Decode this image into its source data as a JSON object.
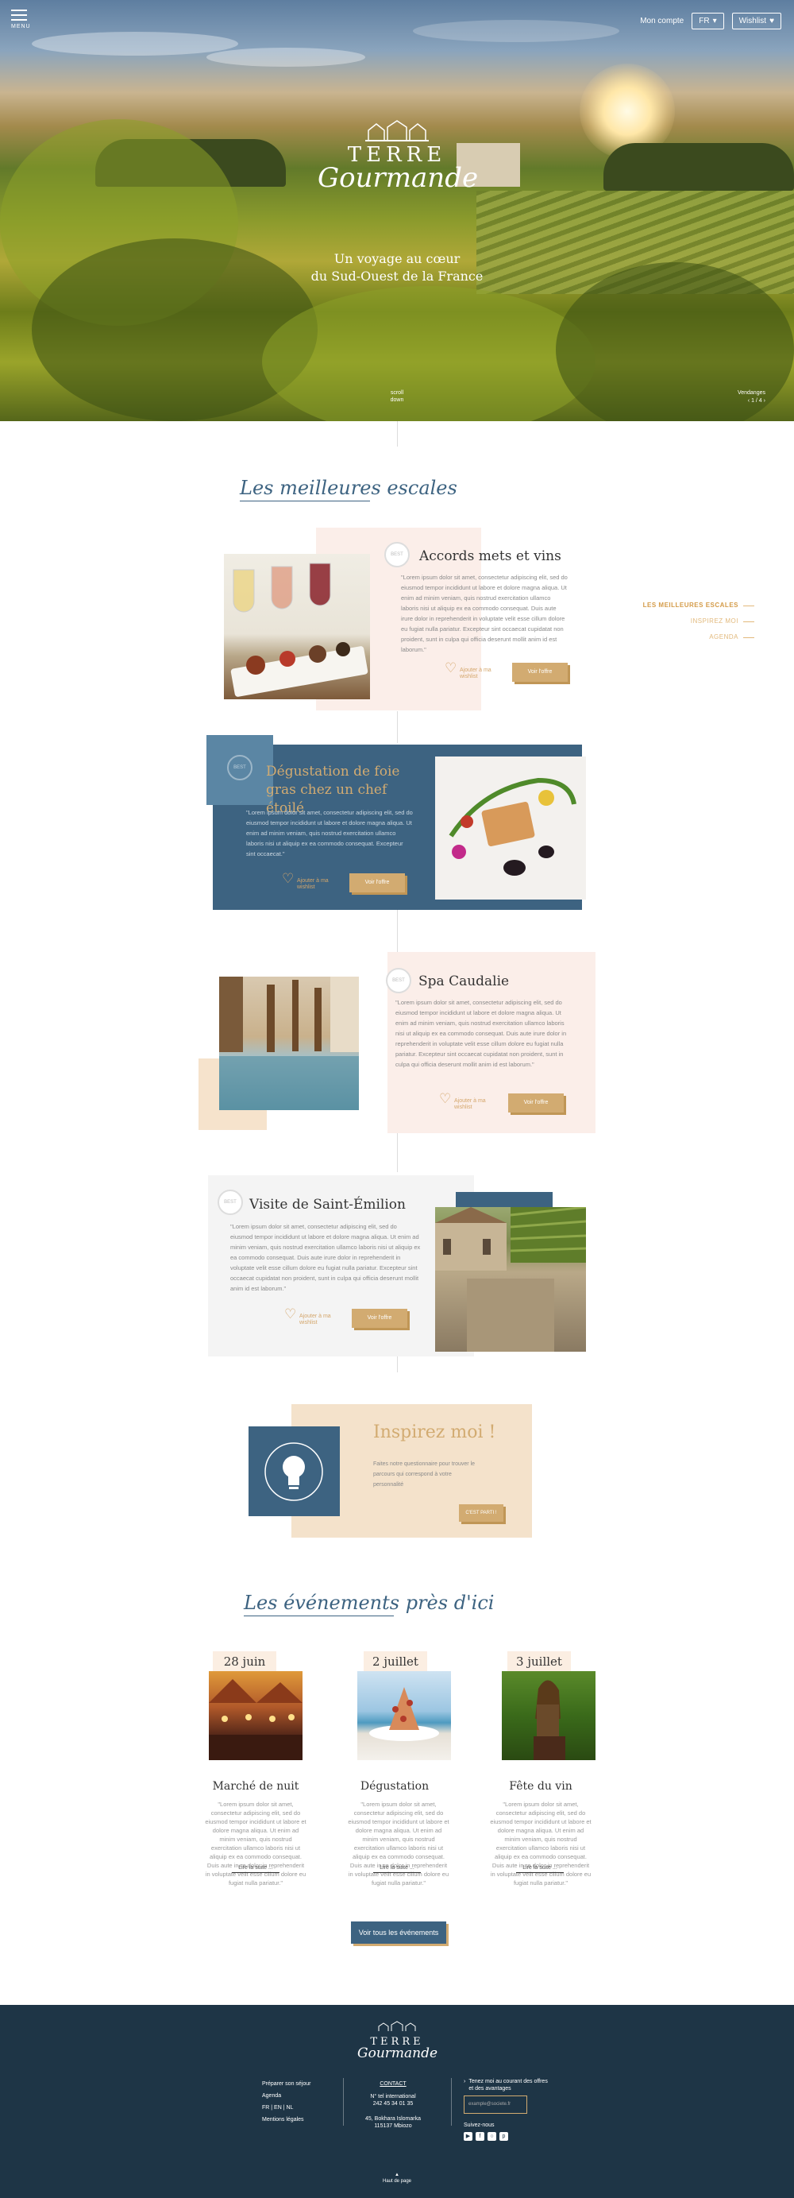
{
  "header": {
    "menu_label": "MENU",
    "account_label": "Mon compte",
    "lang_label": "FR",
    "wishlist_label": "Wishlist"
  },
  "hero": {
    "logo_line1": "TERRE",
    "logo_line2": "Gourmande",
    "tagline_line1": "Un voyage au cœur",
    "tagline_line2": "du Sud-Ouest de la France",
    "scroll_line1": "scroll",
    "scroll_line2": "down",
    "slider_label": "Vendanges",
    "slider_count": "1 / 4"
  },
  "sidenav": {
    "items": [
      {
        "label": "LES MEILLEURES ESCALES"
      },
      {
        "label": "INSPIREZ MOI"
      },
      {
        "label": "AGENDA"
      }
    ]
  },
  "escales": {
    "title": "Les meilleures escales",
    "cards": [
      {
        "badge": "BEST",
        "title": "Accords mets et vins",
        "text": "\"Lorem ipsum dolor sit amet, consectetur adipiscing elit, sed do eiusmod tempor incididunt ut labore et dolore magna aliqua. Ut enim ad minim veniam, quis nostrud exercitation ullamco laboris nisi ut aliquip ex ea commodo consequat. Duis aute irure dolor in reprehenderit in voluptate velit esse cillum dolore eu fugiat nulla pariatur. Excepteur sint occaecat cupidatat non proident, sunt in culpa qui officia deserunt mollit anim id est laborum.\"",
        "wishlist": "Ajouter à ma wishlist",
        "cta": "Voir l'offre"
      },
      {
        "badge": "BEST",
        "title": "Dégustation de foie gras chez un chef étoilé",
        "text": "\"Lorem ipsum dolor sit amet, consectetur adipiscing elit, sed do eiusmod tempor incididunt ut labore et dolore magna aliqua. Ut enim ad minim veniam, quis nostrud exercitation ullamco laboris nisi ut aliquip ex ea commodo consequat. Excepteur sint occaecat.\"",
        "wishlist": "Ajouter à ma wishlist",
        "cta": "Voir l'offre"
      },
      {
        "badge": "BEST",
        "title": "Spa Caudalie",
        "text": "\"Lorem ipsum dolor sit amet, consectetur adipiscing elit, sed do eiusmod tempor incididunt ut labore et dolore magna aliqua. Ut enim ad minim veniam, quis nostrud exercitation ullamco laboris nisi ut aliquip ex ea commodo consequat. Duis aute irure dolor in reprehenderit in voluptate velit esse cillum dolore eu fugiat nulla pariatur. Excepteur sint occaecat cupidatat non proident, sunt in culpa qui officia deserunt mollit anim id est laborum.\"",
        "wishlist": "Ajouter à ma wishlist",
        "cta": "Voir l'offre"
      },
      {
        "badge": "BEST",
        "title": "Visite de Saint-Émilion",
        "text": "\"Lorem ipsum dolor sit amet, consectetur adipiscing elit, sed do eiusmod tempor incididunt ut labore et dolore magna aliqua. Ut enim ad minim veniam, quis nostrud exercitation ullamco laboris nisi ut aliquip ex ea commodo consequat. Duis aute irure dolor in reprehenderit in voluptate velit esse cillum dolore eu fugiat nulla pariatur. Excepteur sint occaecat cupidatat non proident, sunt in culpa qui officia deserunt mollit anim id est laborum.\"",
        "wishlist": "Ajouter à ma wishlist",
        "cta": "Voir l'offre"
      }
    ]
  },
  "inspire": {
    "title": "Inspirez moi !",
    "text": "Faites notre questionnaire pour trouver le parcours qui correspond à votre personnalité",
    "cta": "C'EST PARTI !"
  },
  "events": {
    "title": "Les événements près d'ici",
    "items": [
      {
        "date": "28 juin",
        "title": "Marché de nuit",
        "text": "\"Lorem ipsum dolor sit amet, consectetur adipiscing elit, sed do eiusmod tempor incididunt ut labore et dolore magna aliqua. Ut enim ad minim veniam, quis nostrud exercitation ullamco laboris nisi ut aliquip ex ea commodo consequat. Duis aute irure dolor in reprehenderit in voluptate velit esse cillum dolore eu fugiat nulla pariatur.\"",
        "link": "Lire la suite ..."
      },
      {
        "date": "2 juillet",
        "title": "Dégustation",
        "text": "\"Lorem ipsum dolor sit amet, consectetur adipiscing elit, sed do eiusmod tempor incididunt ut labore et dolore magna aliqua. Ut enim ad minim veniam, quis nostrud exercitation ullamco laboris nisi ut aliquip ex ea commodo consequat. Duis aute irure dolor in reprehenderit in voluptate velit esse cillum dolore eu fugiat nulla pariatur.\"",
        "link": "Lire la suite ..."
      },
      {
        "date": "3 juillet",
        "title": "Fête du vin",
        "text": "\"Lorem ipsum dolor sit amet, consectetur adipiscing elit, sed do eiusmod tempor incididunt ut labore et dolore magna aliqua. Ut enim ad minim veniam, quis nostrud exercitation ullamco laboris nisi ut aliquip ex ea commodo consequat. Duis aute irure dolor in reprehenderit in voluptate velit esse cillum dolore eu fugiat nulla pariatur.\"",
        "link": "Lire la suite ..."
      }
    ],
    "all_cta": "Voir tous les événements"
  },
  "footer": {
    "logo_line1": "TERRE",
    "logo_line2": "Gourmande",
    "links": [
      "Préparer son séjour",
      "Agenda",
      "FR | EN | NL",
      "Mentions légales"
    ],
    "contact_title": "CONTACT",
    "contact_phone_label": "N° tel international",
    "contact_phone": "242 45 34 01 35",
    "contact_address1": "45, Bokhara Islomarka",
    "contact_address2": "115137 Mbiozo",
    "newsletter_text": "Tenez moi au courant des offres et des avantages",
    "newsletter_placeholder": "example@societe.fr",
    "follow_label": "Suivez-nous",
    "top_label": "Haut de page"
  },
  "colors": {
    "brand_blue": "#3d6381",
    "gold": "#d2ab71",
    "blush": "#fbeee9",
    "footer": "#1e3546"
  }
}
